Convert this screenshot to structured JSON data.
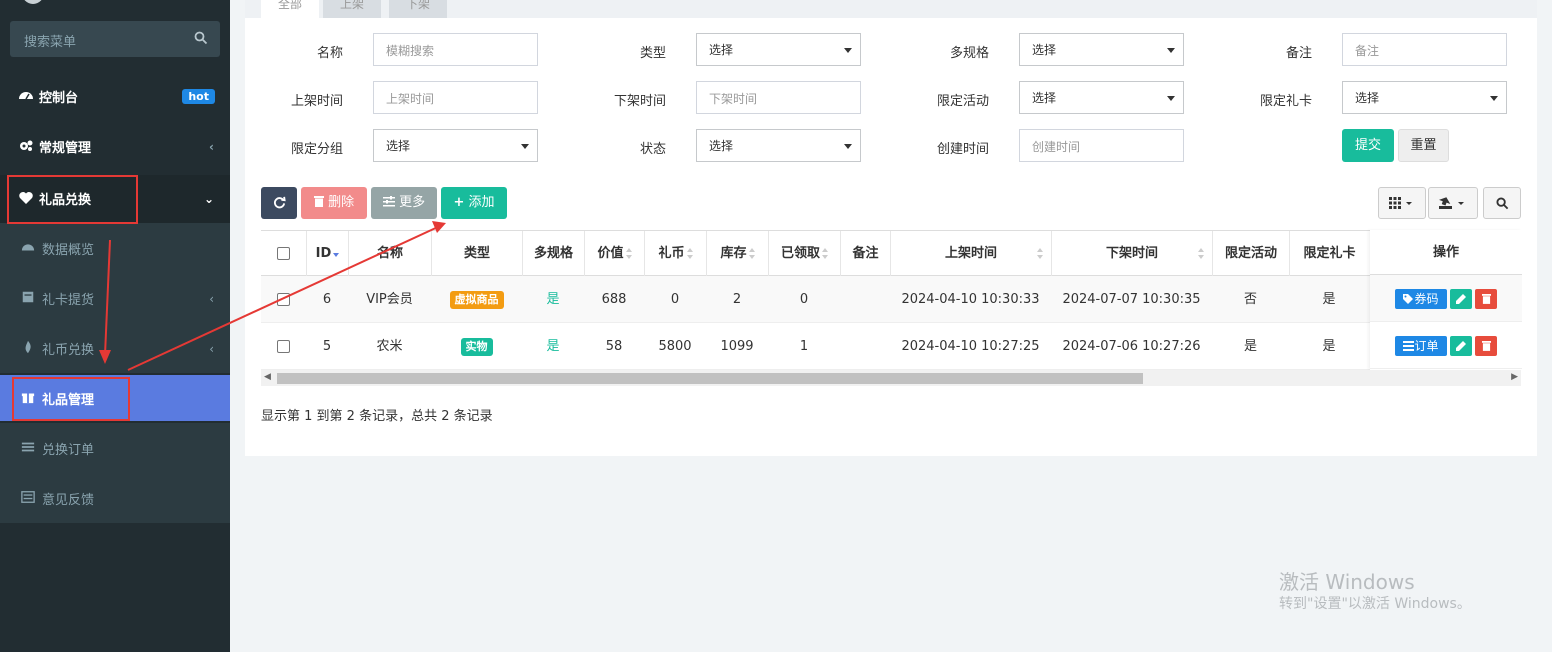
{
  "sidebar": {
    "search_placeholder": "搜索菜单",
    "items": [
      {
        "label": "控制台",
        "badge": "hot"
      },
      {
        "label": "常规管理"
      },
      {
        "label": "礼品兑换"
      }
    ],
    "sub_items": [
      {
        "label": "数据概览"
      },
      {
        "label": "礼卡提货"
      },
      {
        "label": "礼币兑换"
      },
      {
        "label": "礼品管理"
      },
      {
        "label": "兑换订单"
      },
      {
        "label": "意见反馈"
      }
    ]
  },
  "tabs": [
    "全部",
    "上架",
    "下架"
  ],
  "filters": {
    "name": {
      "label": "名称",
      "placeholder": "模糊搜索"
    },
    "type": {
      "label": "类型",
      "value": "选择"
    },
    "multispec": {
      "label": "多规格",
      "value": "选择"
    },
    "remark": {
      "label": "备注",
      "placeholder": "备注"
    },
    "on_time": {
      "label": "上架时间",
      "placeholder": "上架时间"
    },
    "off_time": {
      "label": "下架时间",
      "placeholder": "下架时间"
    },
    "limited_activity": {
      "label": "限定活动",
      "value": "选择"
    },
    "limited_card": {
      "label": "限定礼卡",
      "value": "选择"
    },
    "limited_group": {
      "label": "限定分组",
      "value": "选择"
    },
    "status": {
      "label": "状态",
      "value": "选择"
    },
    "create_time": {
      "label": "创建时间",
      "placeholder": "创建时间"
    },
    "submit": "提交",
    "reset": "重置"
  },
  "toolbar": {
    "delete": "删除",
    "more": "更多",
    "add": "添加"
  },
  "table": {
    "headers": [
      "ID",
      "名称",
      "类型",
      "多规格",
      "价值",
      "礼币",
      "库存",
      "已领取",
      "备注",
      "上架时间",
      "下架时间",
      "限定活动",
      "限定礼卡",
      "操作"
    ],
    "rows": [
      {
        "id": "6",
        "name": "VIP会员",
        "type": "虚拟商品",
        "multispec": "是",
        "value": "688",
        "coin": "0",
        "stock": "2",
        "received": "0",
        "remark": "",
        "on_time": "2024-04-10 10:30:33",
        "off_time": "2024-07-07 10:30:35",
        "limited_activity": "否",
        "limited_card": "是",
        "op_label": "券码"
      },
      {
        "id": "5",
        "name": "农米",
        "type": "实物",
        "multispec": "是",
        "value": "58",
        "coin": "5800",
        "stock": "1099",
        "received": "1",
        "remark": "",
        "on_time": "2024-04-10 10:27:25",
        "off_time": "2024-07-06 10:27:26",
        "limited_activity": "是",
        "limited_card": "是",
        "op_label": "订单"
      }
    ]
  },
  "footer": "显示第 1 到第 2 条记录，总共 2 条记录",
  "watermark": {
    "line1": "激活 Windows",
    "line2": "转到\"设置\"以激活 Windows。"
  },
  "colors": {
    "sidebar_bg": "#222d32",
    "active": "#5a7be0",
    "green": "#18bc9c",
    "delete": "#f28b8b",
    "more": "#95a5a6",
    "refresh": "#3c4a60",
    "tag_virtual": "#f39c12",
    "tag_real": "#18bc9c",
    "op_blue": "#1e88e5",
    "op_red": "#e74c3c",
    "highlight": "#e53935"
  }
}
